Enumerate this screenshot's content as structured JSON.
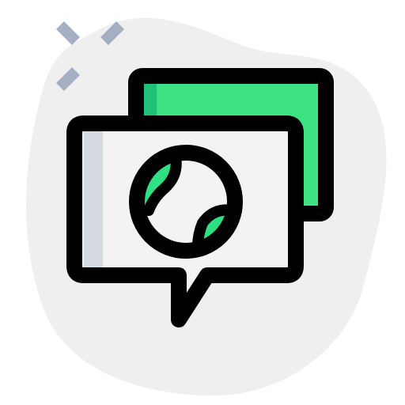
{
  "icon": {
    "name": "global-chat-icon",
    "colors": {
      "blob": "#efefef",
      "sparkle": "#a4afc1",
      "outline": "#000000",
      "back_bubble_fill": "#3ee283",
      "back_bubble_shade": "#1fc174",
      "front_bubble_fill": "#f3f3f1",
      "front_bubble_shade": "#d5dbe1",
      "globe_fill": "#f3f3f1",
      "continent_fill": "#2fdf84",
      "continent_shade": "#1fc174"
    }
  }
}
